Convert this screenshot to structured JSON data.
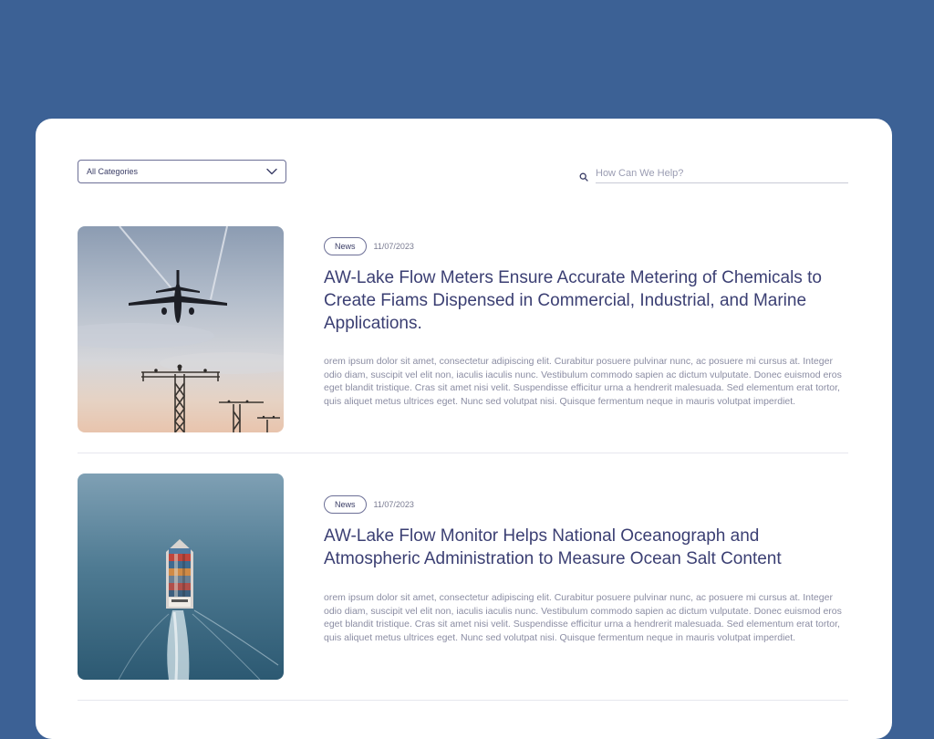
{
  "filters": {
    "category_label": "All Categories",
    "search_placeholder": "How Can We Help?"
  },
  "articles": [
    {
      "tag": "News",
      "date": "11/07/2023",
      "title": "AW-Lake Flow Meters Ensure Accurate Metering of Chemicals to Create Fiams Dispensed in Commercial, Industrial, and Marine Applications.",
      "excerpt": "orem ipsum dolor sit amet, consectetur adipiscing elit. Curabitur posuere pulvinar nunc, ac posuere mi cursus at. Integer odio diam, suscipit vel elit non, iaculis iaculis nunc. Vestibulum commodo sapien ac dictum vulputate. Donec euismod eros eget blandit tristique. Cras sit amet nisi velit. Suspendisse efficitur urna a hendrerit malesuada. Sed elementum erat tortor, quis aliquet metus ultrices eget. Nunc sed volutpat nisi. Quisque fermentum neque in mauris volutpat imperdiet."
    },
    {
      "tag": "News",
      "date": "11/07/2023",
      "title": "AW-Lake Flow Monitor Helps National Oceanograph and Atmospheric Administration to Measure Ocean Salt Content",
      "excerpt": "orem ipsum dolor sit amet, consectetur adipiscing elit. Curabitur posuere pulvinar nunc, ac posuere mi cursus at. Integer odio diam, suscipit vel elit non, iaculis iaculis nunc. Vestibulum commodo sapien ac dictum vulputate. Donec euismod eros eget blandit tristique. Cras sit amet nisi velit. Suspendisse efficitur urna a hendrerit malesuada. Sed elementum erat tortor, quis aliquet metus ultrices eget. Nunc sed volutpat nisi. Quisque fermentum neque in mauris volutpat imperdiet."
    }
  ],
  "icons": {
    "dropdown": "chevron-down-icon",
    "search": "search-icon"
  },
  "colors": {
    "page_background": "#3c6195",
    "card_background": "#ffffff",
    "title_text": "#3b3f73",
    "body_text": "#8b8da3"
  }
}
